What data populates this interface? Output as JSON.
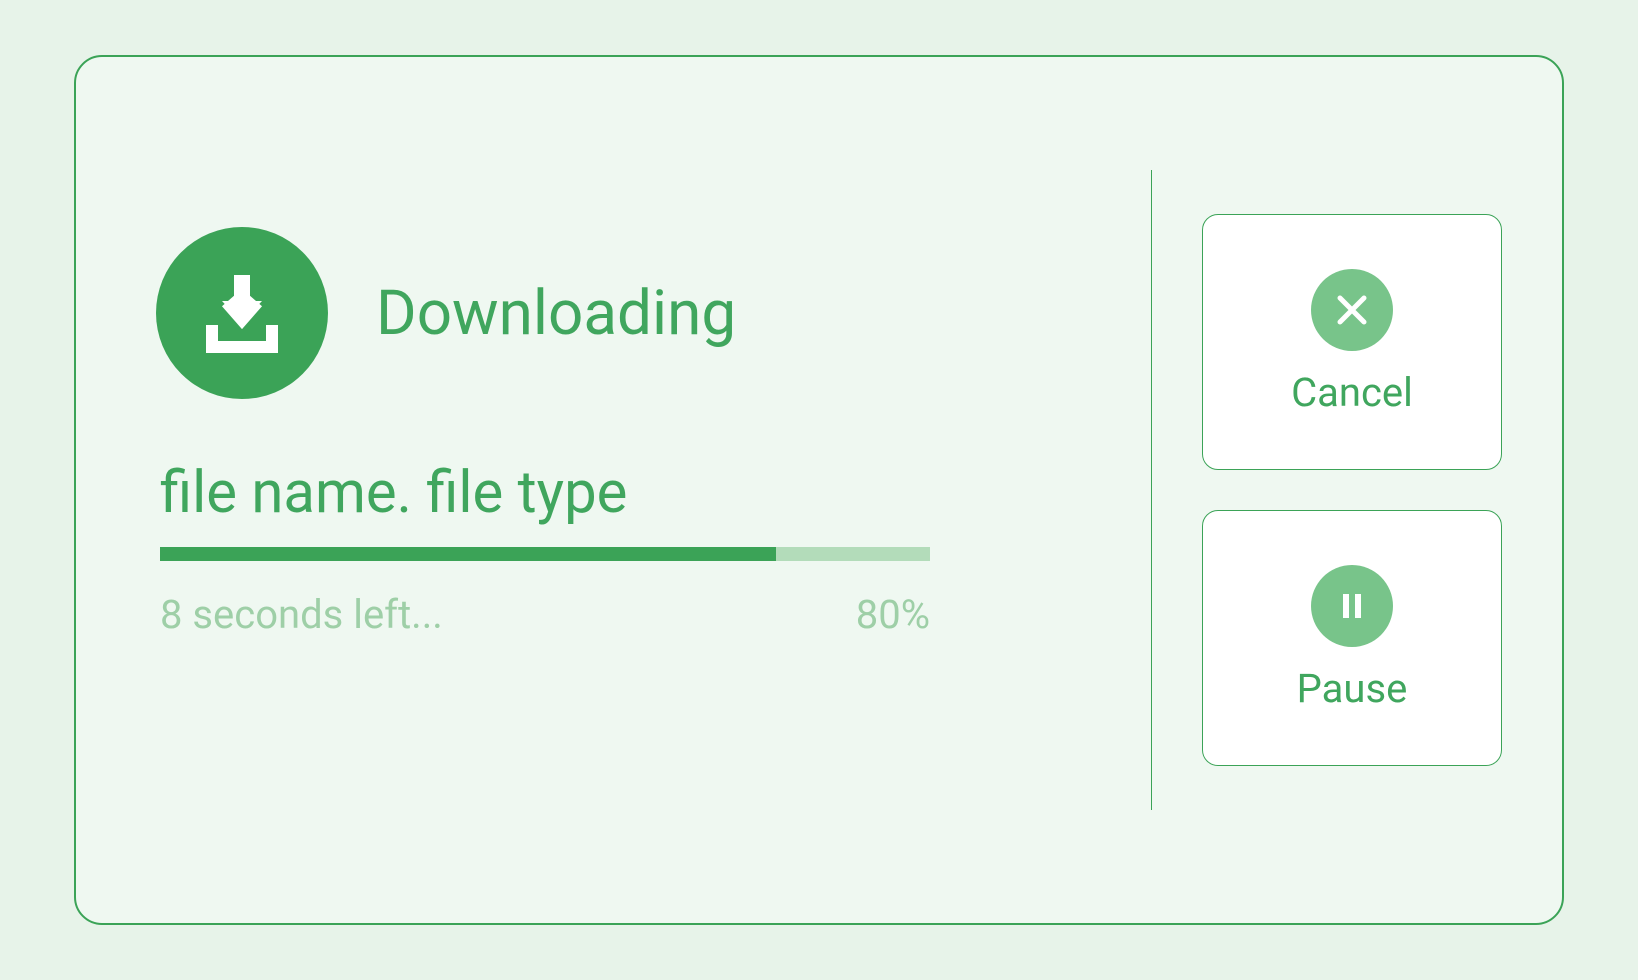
{
  "download": {
    "title": "Downloading",
    "filename": "file name. file type",
    "time_remaining": "8 seconds left...",
    "progress_percent_label": "80%",
    "progress_percent": 80
  },
  "actions": {
    "cancel_label": "Cancel",
    "pause_label": "Pause"
  },
  "icons": {
    "download": "download-icon",
    "cancel": "close-icon",
    "pause": "pause-icon"
  },
  "colors": {
    "accent": "#3ba357",
    "accent_light": "#78c48a",
    "track": "#b3dcba",
    "text_primary": "#40a65e",
    "text_muted": "#9ecfa7",
    "dialog_bg": "#eff8f1",
    "page_bg": "#e7f3e9",
    "button_bg": "#ffffff"
  }
}
